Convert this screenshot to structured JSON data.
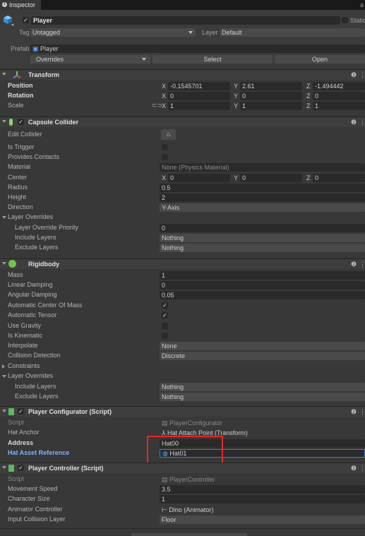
{
  "tab": {
    "label": "Inspector",
    "lock_glyph": "a"
  },
  "object": {
    "active": "✓",
    "name": "Player",
    "static_label": "Static",
    "tag_label": "Tag",
    "tag_value": "Untagged",
    "layer_label": "Layer",
    "layer_value": "Default",
    "prefab_label": "Prefab",
    "prefab_value": "Player",
    "overrides_label": "Overrides",
    "select_label": "Select",
    "open_label": "Open"
  },
  "transform": {
    "title": "Transform",
    "position_label": "Position",
    "position": {
      "x": "-0.1545701",
      "y": "2.61",
      "z": "-1.494442"
    },
    "rotation_label": "Rotation",
    "rotation": {
      "x": "0",
      "y": "0",
      "z": "0"
    },
    "scale_label": "Scale",
    "scale": {
      "x": "1",
      "y": "1",
      "z": "1"
    },
    "axis": {
      "x": "X",
      "y": "Y",
      "z": "Z"
    }
  },
  "capsule": {
    "title": "Capsule Collider",
    "edit_collider": "Edit Collider",
    "is_trigger": "Is Trigger",
    "provides_contacts": "Provides Contacts",
    "material_label": "Material",
    "material_value": "None (Physics Material)",
    "center_label": "Center",
    "center": {
      "x": "0",
      "y": "0",
      "z": "0"
    },
    "radius_label": "Radius",
    "radius": "0.5",
    "height_label": "Height",
    "height": "2",
    "direction_label": "Direction",
    "direction": "Y-Axis",
    "layer_overrides": "Layer Overrides",
    "priority_label": "Layer Override Priority",
    "priority": "0",
    "include_label": "Include Layers",
    "include": "Nothing",
    "exclude_label": "Exclude Layers",
    "exclude": "Nothing"
  },
  "rigidbody": {
    "title": "Rigidbody",
    "mass_label": "Mass",
    "mass": "1",
    "linear_label": "Linear Damping",
    "linear": "0",
    "angular_label": "Angular Damping",
    "angular": "0.05",
    "auto_com_label": "Automatic Center Of Mass",
    "auto_com": "✓",
    "auto_tensor_label": "Automatic Tensor",
    "auto_tensor": "✓",
    "gravity_label": "Use Gravity",
    "kinematic_label": "Is Kinematic",
    "interpolate_label": "Interpolate",
    "interpolate": "None",
    "collision_label": "Collision Detection",
    "collision": "Discrete",
    "constraints": "Constraints",
    "layer_overrides": "Layer Overrides",
    "include_label": "Include Layers",
    "include": "Nothing",
    "exclude_label": "Exclude Layers",
    "exclude": "Nothing"
  },
  "configurator": {
    "title": "Player Configurator (Script)",
    "script_label": "Script",
    "script": "PlayerConfigurator",
    "hat_anchor_label": "Hat Anchor",
    "hat_anchor": "Hat Attach Point (Transform)",
    "address_label": "Address",
    "address": "Hat00",
    "hat_ref_label": "Hat Asset Reference",
    "hat_ref": "Hat01"
  },
  "controller": {
    "title": "Player Controller (Script)",
    "script_label": "Script",
    "script": "PlayerController",
    "speed_label": "Movement Speed",
    "speed": "3.5",
    "size_label": "Character Size",
    "size": "1",
    "animator_label": "Animator Controller",
    "animator": "Dino (Animator)",
    "input_label": "Input Collision Layer",
    "input": "Floor"
  },
  "colors": {
    "highlight": "#e32a2a",
    "link": "#7fb3ff",
    "accent": "#3d7bd6"
  }
}
